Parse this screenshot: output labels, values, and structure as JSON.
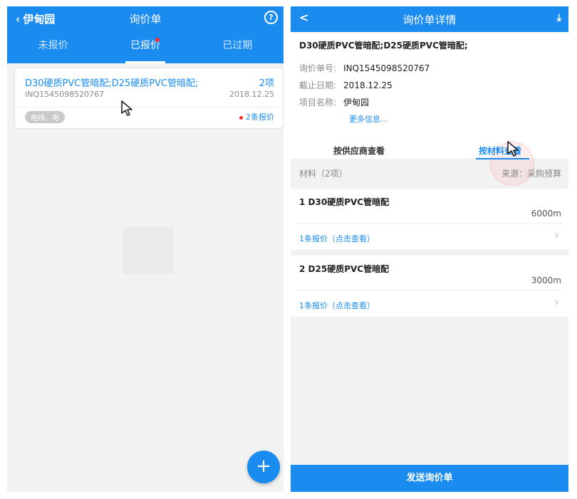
{
  "left_panel": {
    "header": {
      "back_label": "伊甸园",
      "title": "询价单"
    },
    "tabs": [
      {
        "label": "未报价"
      },
      {
        "label": "已报价"
      },
      {
        "label": "已过期"
      }
    ],
    "card": {
      "title": "D30硬质PVC管暗配;D25硬质PVC管暗配;",
      "count": "2项",
      "inquiry_no": "INQ1545098520767",
      "date": "2018.12.25",
      "tag": "电线、电",
      "quotes": "2条报价"
    },
    "fab_label": "+"
  },
  "right_panel": {
    "header": {
      "back_label": "<",
      "title": "询价单详情"
    },
    "info": {
      "title": "D30硬质PVC管暗配;D25硬质PVC管暗配;",
      "inquiry_label": "询价单号:",
      "inquiry_value": "INQ1545098520767",
      "deadline_label": "截止日期:",
      "deadline_value": "2018.12.25",
      "project_label": "项目名称:",
      "project_value": "伊甸园",
      "more": "更多信息..."
    },
    "view_switch": {
      "by_supplier": "按供应商查看",
      "by_material": "按材料查看"
    },
    "materials_header": {
      "left": "材料（2项）",
      "right": "来源：采购预算"
    },
    "materials": [
      {
        "name": "1 D30硬质PVC管暗配",
        "qty": "6000m",
        "link": "1条报价（点击查看）"
      },
      {
        "name": "2 D25硬质PVC管暗配",
        "qty": "3000m",
        "link": "1条报价（点击查看）"
      }
    ],
    "send_button": "发送询价单"
  }
}
